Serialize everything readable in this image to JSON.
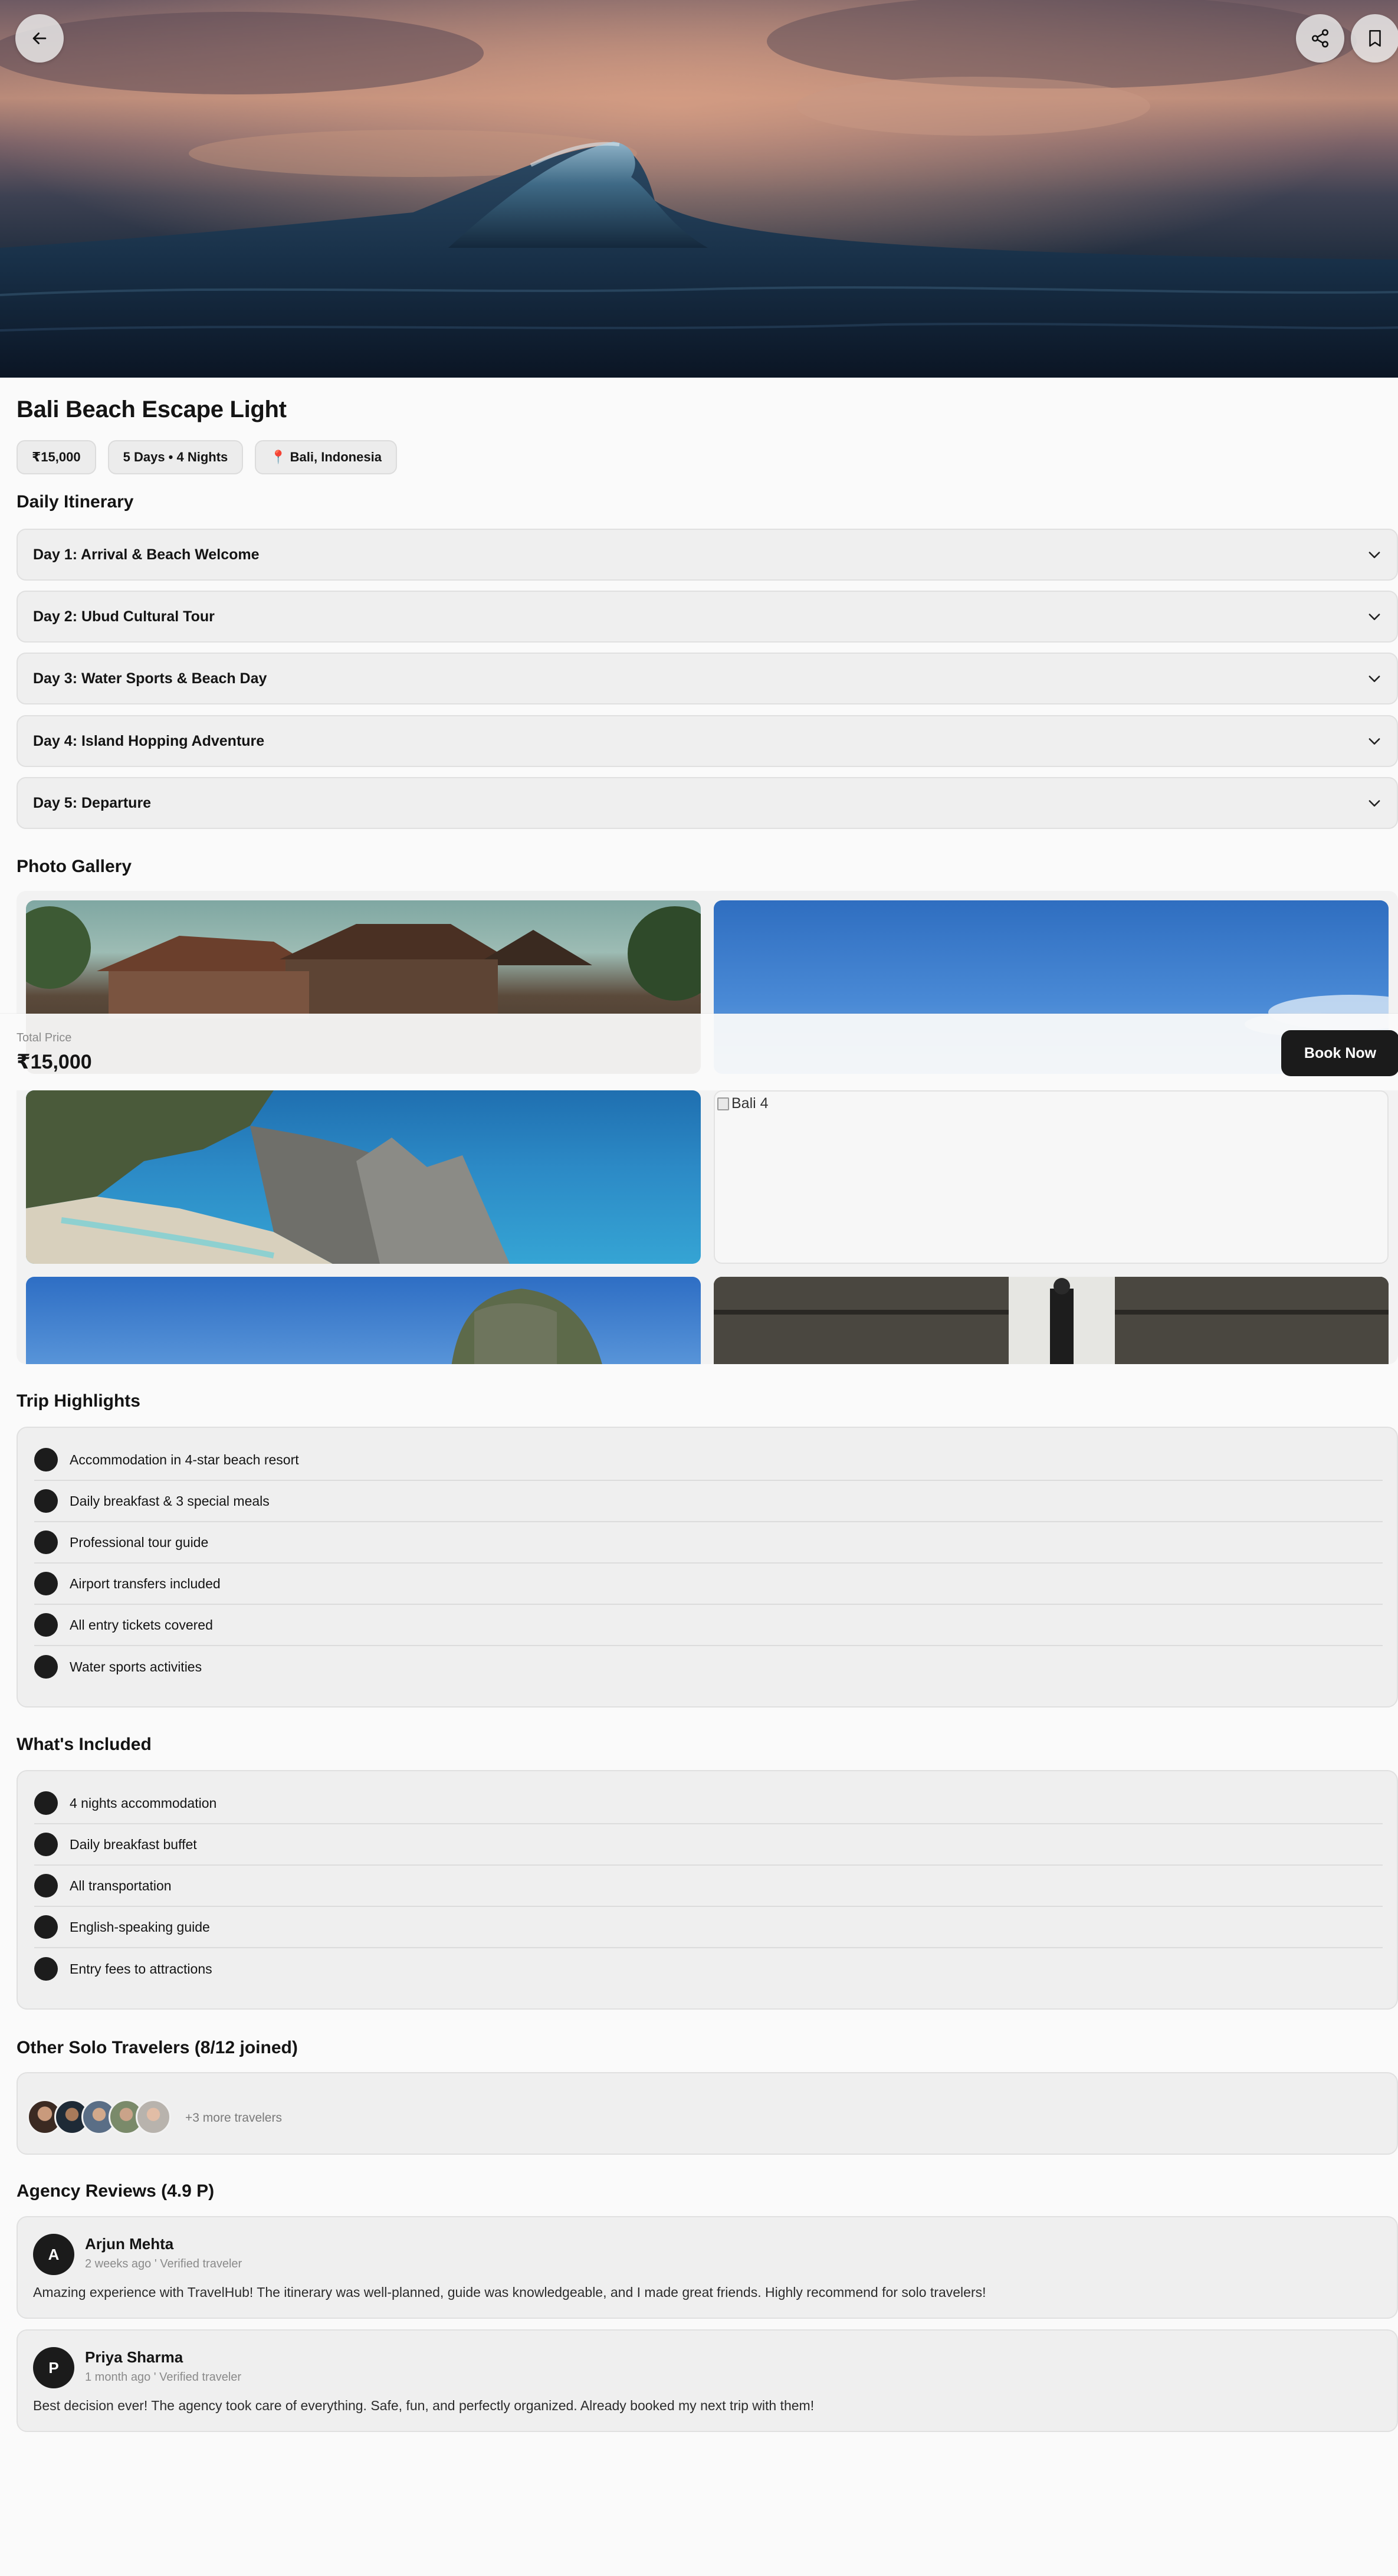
{
  "hero": {
    "back_icon": "arrow-left-icon",
    "share_icon": "share-icon",
    "bookmark_icon": "bookmark-icon"
  },
  "trip": {
    "title": "Bali Beach Escape Light",
    "chips": {
      "price": "₹15,000",
      "duration": "5 Days • 4 Nights",
      "location": "Bali, Indonesia"
    }
  },
  "itinerary": {
    "title": "Daily Itinerary",
    "days": [
      {
        "label": "Day 1: Arrival & Beach Welcome"
      },
      {
        "label": "Day 2: Ubud Cultural Tour"
      },
      {
        "label": "Day 3: Water Sports & Beach Day"
      },
      {
        "label": "Day 4: Island Hopping Adventure"
      },
      {
        "label": "Day 5: Departure"
      }
    ]
  },
  "gallery": {
    "title": "Photo Gallery",
    "broken_alt": "Bali 4"
  },
  "pricebar": {
    "label": "Total Price",
    "value": "₹15,000",
    "book_label": "Book Now"
  },
  "highlights": {
    "title": "Trip Highlights",
    "items": [
      "Accommodation in 4-star beach resort",
      "Daily breakfast & 3 special meals",
      "Professional tour guide",
      "Airport transfers included",
      "All entry tickets covered",
      "Water sports activities"
    ]
  },
  "included": {
    "title": "What's Included",
    "items": [
      "4 nights accommodation",
      "Daily breakfast buffet",
      "All transportation",
      "English-speaking guide",
      "Entry fees to attractions"
    ]
  },
  "travelers": {
    "title": "Other Solo Travelers (8/12 joined)",
    "more": "+3 more travelers"
  },
  "reviews": {
    "title": "Agency Reviews (4.9 P)",
    "items": [
      {
        "initial": "A",
        "name": "Arjun Mehta",
        "meta": "2 weeks ago ' Verified traveler",
        "body": "Amazing experience with TravelHub! The itinerary was well-planned, guide was knowledgeable, and I made great friends. Highly recommend for solo travelers!"
      },
      {
        "initial": "P",
        "name": "Priya Sharma",
        "meta": "1 month ago ' Verified traveler",
        "body": "Best decision ever! The agency took care of everything. Safe, fun, and perfectly organized. Already booked my next trip with them!"
      }
    ]
  }
}
